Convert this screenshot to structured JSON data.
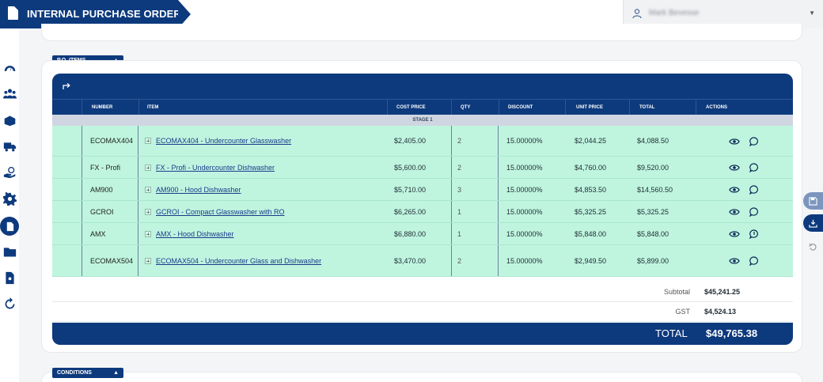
{
  "header": {
    "title": "INTERNAL PURCHASE ORDERS",
    "user_name": "Mark Bevesse"
  },
  "sidebar": {
    "items": [
      {
        "icon": "dashboard-gauge-icon"
      },
      {
        "icon": "users-icon"
      },
      {
        "icon": "boxes-icon"
      },
      {
        "icon": "truck-icon"
      },
      {
        "icon": "money-hand-icon"
      },
      {
        "icon": "gear-icon"
      },
      {
        "icon": "purchase-order-icon",
        "active": true
      },
      {
        "icon": "folder-icon"
      },
      {
        "icon": "document-search-icon"
      },
      {
        "icon": "refresh-icon"
      }
    ]
  },
  "sections": {
    "po_items_label": "P.O. ITEMS",
    "conditions_label": "CONDITIONS"
  },
  "table": {
    "columns": {
      "number": "NUMBER",
      "item": "ITEM",
      "cost_price": "COST PRICE",
      "qty": "QTY",
      "discount": "DISCOUNT",
      "unit_price": "UNIT PRICE",
      "total": "TOTAL",
      "actions": "ACTIONS"
    },
    "stage_label": "STAGE 1",
    "rows": [
      {
        "number": "ECOMAX404",
        "item": "ECOMAX404 - Undercounter Glasswasher",
        "cost_price": "$2,405.00",
        "qty": "2",
        "discount": "15.00000%",
        "unit_price": "$2,044.25",
        "total": "$4,088.50"
      },
      {
        "number": "FX - Profi",
        "item": "FX - Profi - Undercounter Dishwasher",
        "cost_price": "$5,600.00",
        "qty": "2",
        "discount": "15.00000%",
        "unit_price": "$4,760.00",
        "total": "$9,520.00"
      },
      {
        "number": "AM900",
        "item": "AM900 - Hood Dishwasher",
        "cost_price": "$5,710.00",
        "qty": "3",
        "discount": "15.00000%",
        "unit_price": "$4,853.50",
        "total": "$14,560.50"
      },
      {
        "number": "GCROI",
        "item": "GCROI - Compact Glasswasher with RO",
        "cost_price": "$6,265.00",
        "qty": "1",
        "discount": "15.00000%",
        "unit_price": "$5,325.25",
        "total": "$5,325.25"
      },
      {
        "number": "AMX",
        "item": "AMX - Hood Dishwasher",
        "cost_price": "$6,880.00",
        "qty": "1",
        "discount": "15.00000%",
        "unit_price": "$5,848.00",
        "total": "$5,848.00"
      },
      {
        "number": "ECOMAX504",
        "item": "ECOMAX504 - Undercounter Glass and Dishwasher",
        "cost_price": "$3,470.00",
        "qty": "2",
        "discount": "15.00000%",
        "unit_price": "$2,949.50",
        "total": "$5,899.00"
      }
    ],
    "subtotal_label": "Subtotal",
    "subtotal_value": "$45,241.25",
    "gst_label": "GST",
    "gst_value": "$4,524.13",
    "total_label": "TOTAL",
    "total_value": "$49,765.38"
  },
  "colors": {
    "brand": "#0d3a7d",
    "row_highlight": "#bff5df",
    "stage_bar": "#cfd6e2"
  }
}
